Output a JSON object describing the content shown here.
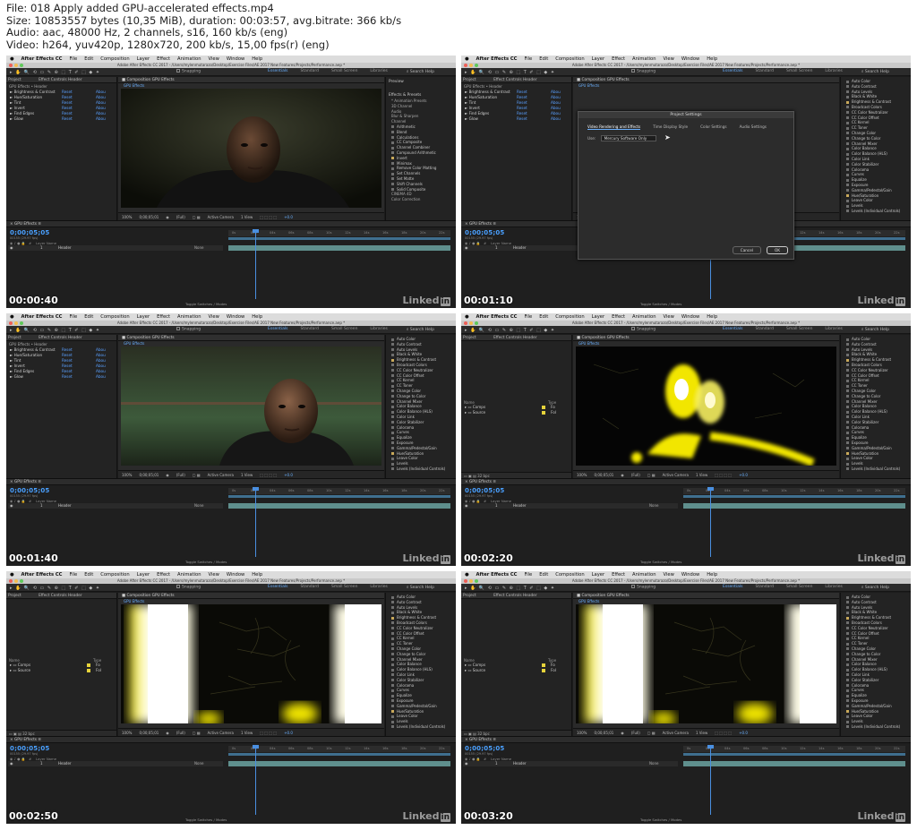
{
  "info": {
    "line1": "File: 018 Apply added GPU-accelerated effects.mp4",
    "line2": "Size: 10853557 bytes (10,35 MiB), duration: 00:03:57, avg.bitrate: 366 kb/s",
    "line3": "Audio: aac, 48000 Hz, 2 channels, s16, 160 kb/s (eng)",
    "line4": "Video: h264, yuv420p, 1280x720, 200 kb/s, 15,00 fps(r) (eng)"
  },
  "menu": {
    "app": "After Effects CC",
    "items": [
      "File",
      "Edit",
      "Composition",
      "Layer",
      "Effect",
      "Animation",
      "View",
      "Window",
      "Help"
    ]
  },
  "window_title": "Adobe After Effects CC 2017 - /Users/mylenmutarazo/Desktop/Exercise Files/AE 2017 New Features/Projects/Performance.aep *",
  "toolbar": {
    "snapping": "Snapping",
    "workspaces": [
      "Essentials",
      "Standard",
      "Small Screen",
      "Libraries"
    ],
    "search": "Search Help"
  },
  "left_panel": {
    "tab_project": "Project",
    "tab_effect": "Effect Controls Header",
    "subheader": "GPU Effects • Header",
    "reset": "Reset",
    "about": "Abou",
    "effects": [
      "Brightness & Contrast",
      "Hue/Saturation",
      "Tint",
      "Invert",
      "Find Edges",
      "Glow"
    ],
    "glow_options": "Options...",
    "project_cols": [
      "Name",
      "Type"
    ],
    "project_items": [
      {
        "name": "Comps",
        "type": "Fo"
      },
      {
        "name": "Source",
        "type": "Fol"
      }
    ],
    "bpc": "32 bpc"
  },
  "viewer": {
    "tab": "Composition GPU Effects",
    "sub": "GPU Effects",
    "zoom": "100%",
    "timecode": "0;00;05;01",
    "resolution": "(Full)",
    "camera": "Active Camera",
    "views": "1 View",
    "exposure": "+0.0"
  },
  "right_panel": {
    "preview": "Preview",
    "effects_presets": "Effects & Presets",
    "categories": [
      "* Animation Presets",
      "3D Channel",
      "Audio",
      "Blur & Sharpen",
      "Channel"
    ],
    "channel_items": [
      "Arithmetic",
      "Blend",
      "Calculations",
      "CC Composite",
      "Channel Combiner",
      "Compound Arithmetic",
      "Invert",
      "Minimax",
      "Remove Color Matting",
      "Set Channels",
      "Set Matte",
      "Shift Channels",
      "Solid Composite"
    ],
    "trailing_categories": [
      "CINEMA 4D",
      "Color Correction"
    ],
    "color_items": [
      "Auto Color",
      "Auto Contrast",
      "Auto Levels",
      "Black & White",
      "Brightness & Contrast",
      "Broadcast Colors",
      "CC Color Neutralizer",
      "CC Color Offset",
      "CC Kernel",
      "CC Toner",
      "Change Color",
      "Change to Color",
      "Channel Mixer",
      "Color Balance",
      "Color Balance (HLS)",
      "Color Link",
      "Color Stabilizer",
      "Colorama",
      "Curves",
      "Equalize",
      "Exposure",
      "Gamma/Pedestal/Gain",
      "Hue/Saturation",
      "Leave Color",
      "Levels",
      "Levels (Individual Controls)"
    ]
  },
  "timeline": {
    "tab": "GPU Effects",
    "timecode": "0;00;05;05",
    "timecode_sub": "00155 (29.97 fps)",
    "cols": "Layer Name",
    "layer_num": "1",
    "layer_name": "Header",
    "parent": "None",
    "toggle": "Toggle Switches / Modes",
    "ruler": [
      "0s",
      "02s",
      "04s",
      "06s",
      "08s",
      "10s",
      "12s",
      "14s",
      "16s",
      "18s",
      "20s",
      "22s"
    ]
  },
  "dialog": {
    "title": "Project Settings",
    "tabs": [
      "Video Rendering and Effects",
      "Time Display Style",
      "Color Settings",
      "Audio Settings"
    ],
    "use_label": "Use:",
    "use_value": "Mercury Software Only",
    "cancel": "Cancel",
    "ok": "OK"
  },
  "brand": {
    "text": "Linked",
    "badge": "in"
  },
  "frames": [
    {
      "time": "00:00:40",
      "layout": "effects",
      "scene": "person-dark",
      "dialog": false
    },
    {
      "time": "00:01:10",
      "layout": "effects",
      "scene": "blank",
      "dialog": true
    },
    {
      "time": "00:01:40",
      "layout": "effects",
      "scene": "person-field",
      "dialog": false
    },
    {
      "time": "00:02:20",
      "layout": "project",
      "scene": "edges-yellow",
      "dialog": false
    },
    {
      "time": "00:02:50",
      "layout": "project",
      "scene": "glow-bright",
      "dialog": false
    },
    {
      "time": "00:03:20",
      "layout": "project",
      "scene": "glow-bright",
      "dialog": false
    }
  ],
  "colors": {
    "accent": "#4aa0ff",
    "glow": "#f2e600",
    "menubar": "#dcdcdc",
    "panel": "#232323"
  }
}
